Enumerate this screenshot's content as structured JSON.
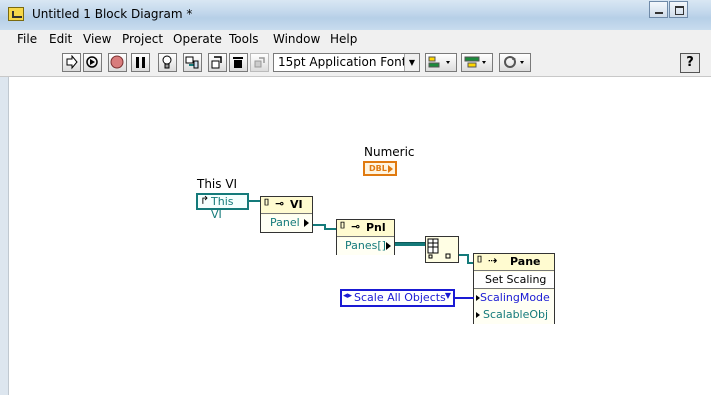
{
  "window": {
    "title": "Untitled 1 Block Diagram *"
  },
  "menu": [
    {
      "label": "File"
    },
    {
      "label": "Edit"
    },
    {
      "label": "View"
    },
    {
      "label": "Project"
    },
    {
      "label": "Operate"
    },
    {
      "label": "Tools"
    },
    {
      "label": "Window"
    },
    {
      "label": "Help"
    }
  ],
  "toolbar": {
    "font_select": "15pt Application Font",
    "help_label": "?"
  },
  "diagram": {
    "numeric_label": "Numeric",
    "numeric_type": "DBL",
    "this_vi_label": "This VI",
    "this_vi_text": "This VI",
    "vi_node": {
      "class": "VI",
      "property": "Panel"
    },
    "pnl_node": {
      "class": "Pnl",
      "property": "Panes[]"
    },
    "pane_node": {
      "class": "Pane",
      "method": "Set Scaling",
      "inputs": [
        "ScalingMode",
        "ScalableObj"
      ]
    },
    "enum_constant": "Scale All Objects"
  },
  "colors": {
    "wire": "#147a7a",
    "dbl_orange": "#e07a10",
    "enum_blue": "#1a1ad4",
    "refnum_green": "#147a7a"
  }
}
